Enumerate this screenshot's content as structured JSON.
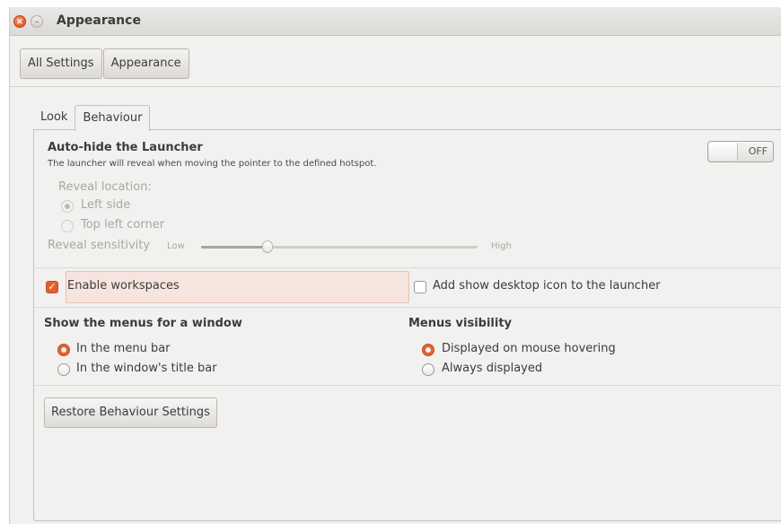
{
  "window": {
    "title": "Appearance",
    "close_glyph": "×",
    "min_glyph": "–"
  },
  "breadcrumb": {
    "items": [
      "All Settings",
      "Appearance"
    ]
  },
  "tabs": [
    {
      "label": "Look"
    },
    {
      "label": "Behaviour"
    }
  ],
  "autohide": {
    "title": "Auto-hide the Launcher",
    "description": "The launcher will reveal when moving the pointer to the defined hotspot.",
    "toggle_label": "OFF",
    "reveal_location_label": "Reveal location:",
    "options": [
      "Left side",
      "Top left corner"
    ],
    "sensitivity_label": "Reveal sensitivity",
    "sensitivity_low": "Low",
    "sensitivity_high": "High",
    "sensitivity_value": 0.24
  },
  "workspaces": {
    "label": "Enable workspaces",
    "checked": true
  },
  "desktop_icon": {
    "label": "Add show desktop icon to the launcher",
    "checked": false
  },
  "menus": {
    "title": "Show the menus for a window",
    "options": [
      "In the menu bar",
      "In the window's title bar"
    ]
  },
  "visibility": {
    "title": "Menus visibility",
    "options": [
      "Displayed on mouse hovering",
      "Always displayed"
    ]
  },
  "restore_button": "Restore Behaviour Settings",
  "colors": {
    "accent": "#e0612f",
    "background": "#f2f1f0"
  }
}
